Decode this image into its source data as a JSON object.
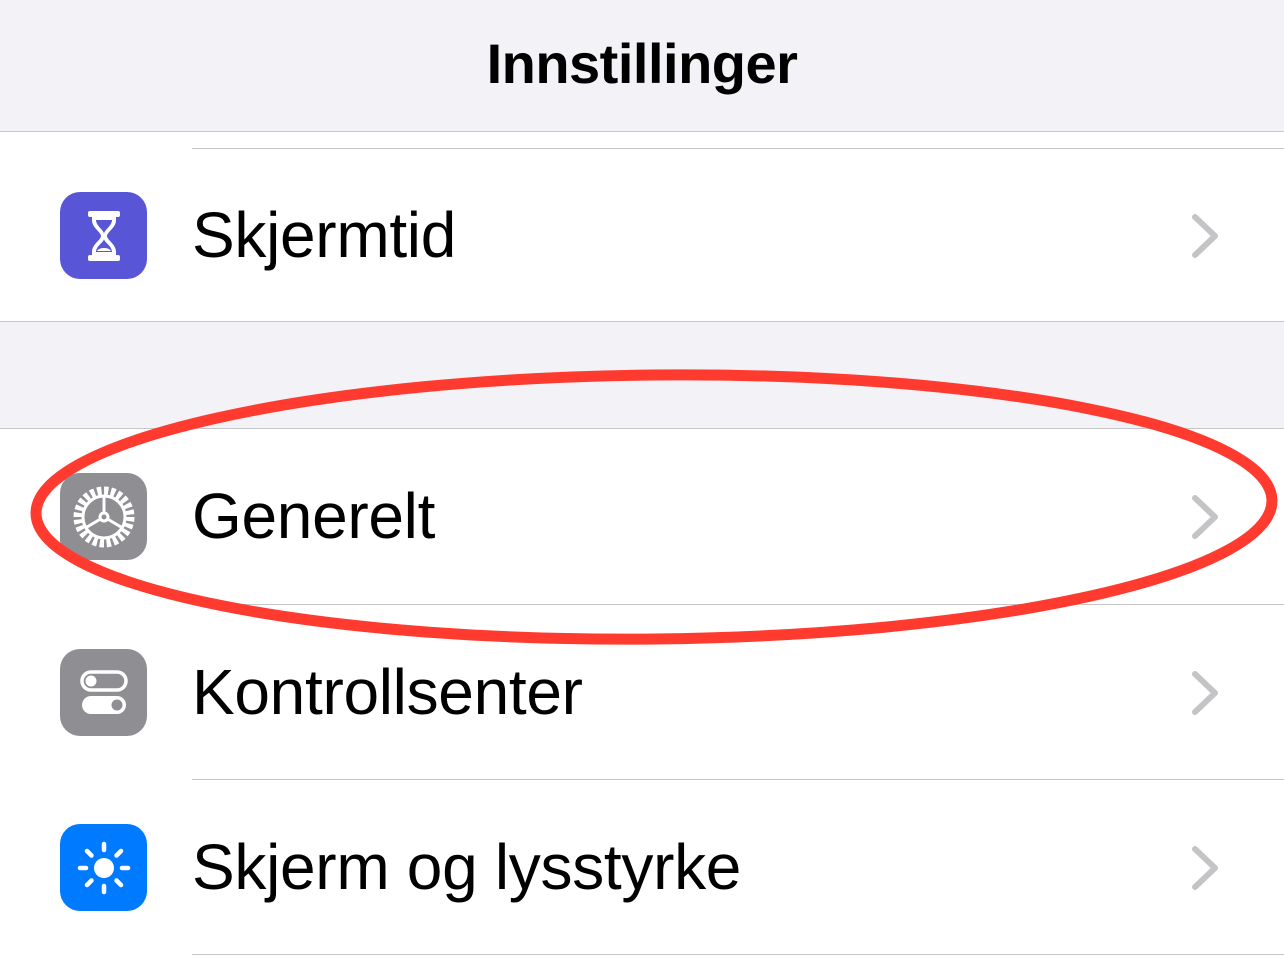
{
  "nav": {
    "title": "Innstillinger"
  },
  "colors": {
    "background": "#f2f2f7",
    "cell": "#ffffff",
    "separator": "#c6c6c8",
    "chevron": "#c4c4c7",
    "annotation": "#ff3b30"
  },
  "groups": [
    {
      "rows": [
        {
          "label": "Skjermtid",
          "icon": "hourglass-icon",
          "icon_color": "#5856d6"
        }
      ]
    },
    {
      "rows": [
        {
          "label": "Generelt",
          "icon": "gear-icon",
          "icon_color": "#8e8e93",
          "highlighted": true
        },
        {
          "label": "Kontrollsenter",
          "icon": "toggles-icon",
          "icon_color": "#8e8e93"
        },
        {
          "label": "Skjerm og lysstyrke",
          "icon": "sun-icon",
          "icon_color": "#007aff"
        }
      ]
    }
  ]
}
